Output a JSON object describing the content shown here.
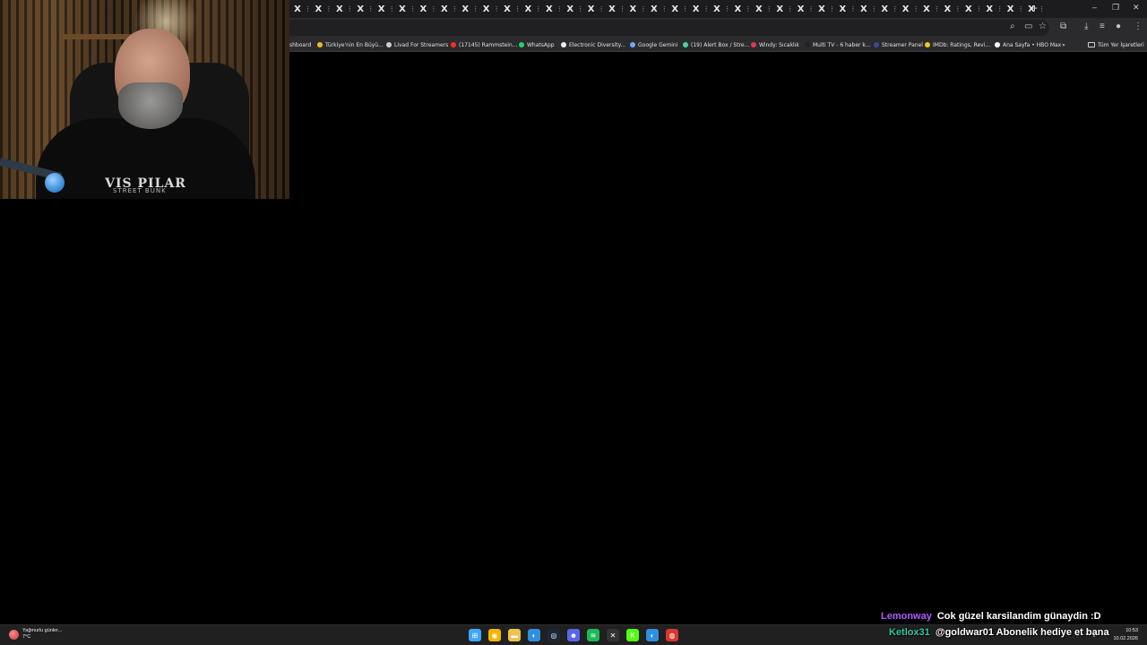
{
  "browser": {
    "tabs": [
      {
        "icon": "x-logo-icon"
      },
      {
        "icon": "x-logo-icon"
      },
      {
        "icon": "x-logo-icon"
      },
      {
        "icon": "x-logo-icon"
      },
      {
        "icon": "x-logo-icon"
      },
      {
        "icon": "x-logo-icon"
      },
      {
        "icon": "x-logo-icon"
      },
      {
        "icon": "x-logo-icon"
      },
      {
        "icon": "x-logo-icon"
      },
      {
        "icon": "x-logo-icon"
      },
      {
        "icon": "x-logo-icon"
      },
      {
        "icon": "x-logo-icon"
      },
      {
        "icon": "x-logo-icon"
      },
      {
        "icon": "x-logo-icon"
      },
      {
        "icon": "x-logo-icon"
      },
      {
        "icon": "x-logo-icon"
      },
      {
        "icon": "x-logo-icon"
      },
      {
        "icon": "x-logo-icon"
      },
      {
        "icon": "x-logo-icon"
      },
      {
        "icon": "x-logo-icon"
      },
      {
        "icon": "x-logo-icon"
      },
      {
        "icon": "x-logo-icon"
      },
      {
        "icon": "x-logo-icon"
      },
      {
        "icon": "x-logo-icon"
      },
      {
        "icon": "x-logo-icon"
      },
      {
        "icon": "x-logo-icon"
      },
      {
        "icon": "x-logo-icon"
      },
      {
        "icon": "x-logo-icon"
      },
      {
        "icon": "x-logo-icon"
      },
      {
        "icon": "x-logo-icon"
      },
      {
        "icon": "x-logo-icon"
      },
      {
        "icon": "x-logo-icon"
      },
      {
        "icon": "x-logo-icon"
      },
      {
        "icon": "x-logo-icon"
      },
      {
        "icon": "x-logo-icon"
      },
      {
        "icon": "x-logo-icon"
      }
    ],
    "tab_glyph": "X",
    "tab_close_glyph": "⋮",
    "new_tab_glyph": "+",
    "window_controls": {
      "minimize": "–",
      "restore": "❐",
      "close": "✕"
    },
    "bookmarks": [
      {
        "label": "shboard",
        "color": "#888888"
      },
      {
        "label": "Türkiye'nin En Büyü...",
        "color": "#f2b632"
      },
      {
        "label": "Livad For Streamers",
        "color": "#cccccc"
      },
      {
        "label": "(17145) Rammstein...",
        "color": "#ff2a2a"
      },
      {
        "label": "WhatsApp",
        "color": "#25d366"
      },
      {
        "label": "Electronic Diversity...",
        "color": "#eeeeee"
      },
      {
        "label": "Google Gemini",
        "color": "#6ea8ff"
      },
      {
        "label": "(19) Alert Box / Stre...",
        "color": "#4fd1a0"
      },
      {
        "label": "Windy: Sıcaklık",
        "color": "#e0384a"
      },
      {
        "label": "Multi TV - 6 haber k...",
        "color": "#222222"
      },
      {
        "label": "Streamer Panel",
        "color": "#3a4a9c"
      },
      {
        "label": "IMDb: Ratings, Revi...",
        "color": "#f5c518"
      },
      {
        "label": "Ana Sayfa • HBO Max",
        "color": "#ffffff"
      }
    ],
    "bookmarks_overflow": "»",
    "all_bookmarks_label": "Tüm Yer İşaretleri"
  },
  "webcam": {
    "shirt_text": "VIS PILAR",
    "shirt_sub": "STREET BUNK"
  },
  "chat": [
    {
      "user": "Lemonway",
      "user_color": "#b05bff",
      "message": "Cok güzel karsilandim günaydin :D"
    },
    {
      "user": "Ketlox31",
      "user_color": "#32c8a0",
      "message": "@goldwar01 Abonelik hediye et bana"
    }
  ],
  "taskbar": {
    "weather_text": "Yağmurlu günler...",
    "weather_temp": "7°C",
    "time": "10:53",
    "date": "10.02.2026",
    "apps": [
      {
        "name": "windows-start-icon",
        "glyph": "⊞",
        "color": "#3ea6ff"
      },
      {
        "name": "chrome-icon",
        "glyph": "◉",
        "color": "#f4b400"
      },
      {
        "name": "file-explorer-icon",
        "glyph": "▬",
        "color": "#f0c24b"
      },
      {
        "name": "edge-icon",
        "glyph": "◐",
        "color": "#2f8fe0"
      },
      {
        "name": "steam-icon",
        "glyph": "◎",
        "color": "#1b2838"
      },
      {
        "name": "discord-icon",
        "glyph": "☻",
        "color": "#5865f2"
      },
      {
        "name": "spotify-icon",
        "glyph": "≋",
        "color": "#1db954"
      },
      {
        "name": "app-icon",
        "glyph": "✕",
        "color": "#333333"
      },
      {
        "name": "kick-icon",
        "glyph": "K",
        "color": "#53fc18"
      },
      {
        "name": "browser-icon",
        "glyph": "◐",
        "color": "#2f8fe0"
      },
      {
        "name": "app-red-icon",
        "glyph": "◍",
        "color": "#d9362f"
      }
    ]
  }
}
